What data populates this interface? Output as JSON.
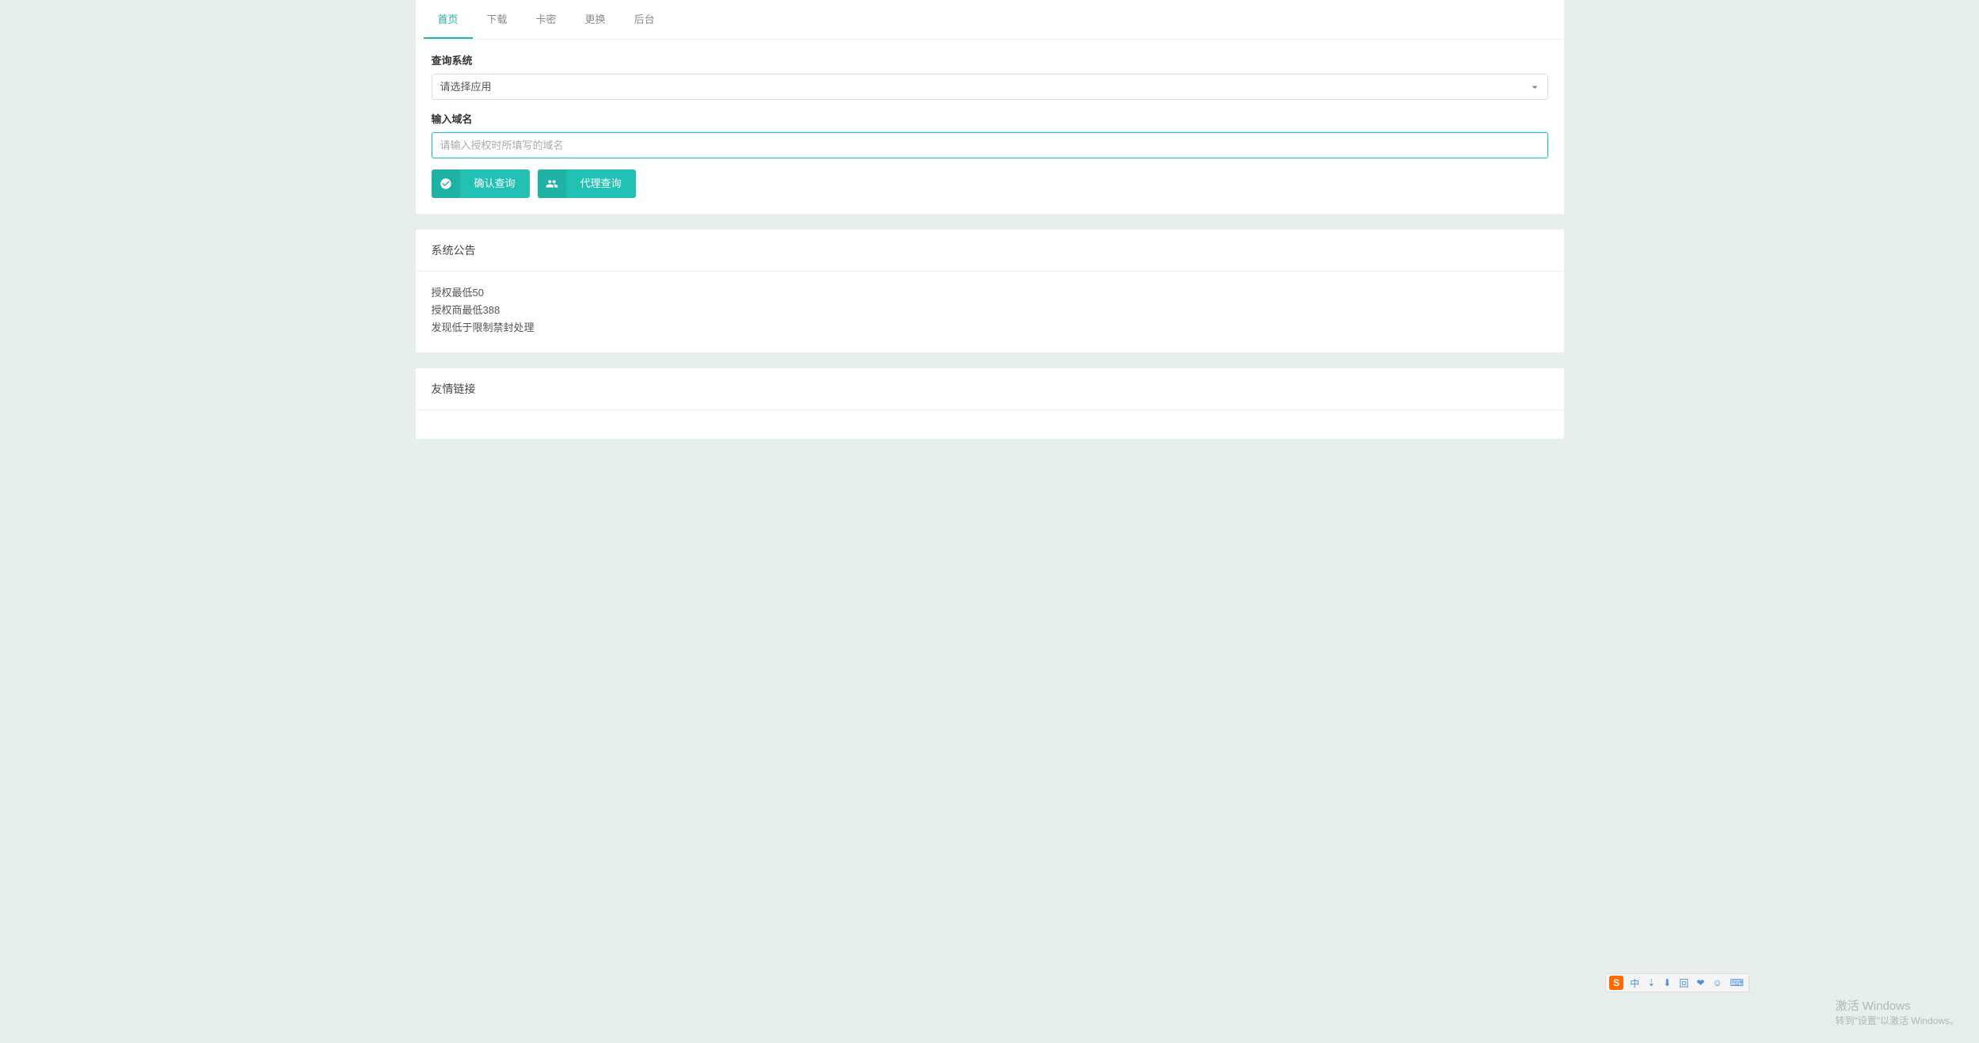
{
  "nav": {
    "tabs": [
      {
        "label": "首页",
        "active": true
      },
      {
        "label": "下载",
        "active": false
      },
      {
        "label": "卡密",
        "active": false
      },
      {
        "label": "更换",
        "active": false
      },
      {
        "label": "后台",
        "active": false
      }
    ]
  },
  "form": {
    "system_label": "查询系统",
    "system_placeholder": "请选择应用",
    "domain_label": "输入域名",
    "domain_placeholder": "请输入授权时所填写的域名",
    "domain_value": "",
    "confirm_label": "确认查询",
    "agent_label": "代理查询"
  },
  "announce": {
    "title": "系统公告",
    "lines": [
      "授权最低50",
      "授权商最低388",
      "发现低于限制禁封处理"
    ]
  },
  "links": {
    "title": "友情链接"
  },
  "watermark": {
    "line1": "激活 Windows",
    "line2": "转到\"设置\"以激活 Windows。"
  },
  "ime": {
    "logo": "S",
    "items": [
      "中",
      "⇣",
      "⬇",
      "回",
      "❤",
      "☺",
      "⌨"
    ]
  }
}
